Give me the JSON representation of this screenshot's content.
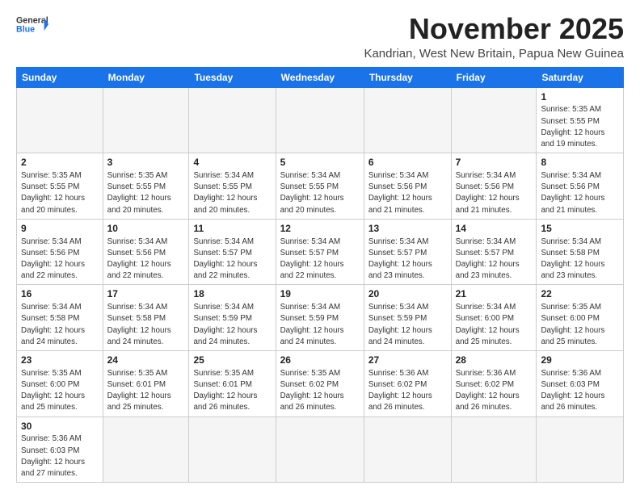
{
  "header": {
    "logo_line1": "General",
    "logo_line2": "Blue",
    "month_title": "November 2025",
    "location": "Kandrian, West New Britain, Papua New Guinea"
  },
  "days_of_week": [
    "Sunday",
    "Monday",
    "Tuesday",
    "Wednesday",
    "Thursday",
    "Friday",
    "Saturday"
  ],
  "weeks": [
    [
      {
        "day": "",
        "info": ""
      },
      {
        "day": "",
        "info": ""
      },
      {
        "day": "",
        "info": ""
      },
      {
        "day": "",
        "info": ""
      },
      {
        "day": "",
        "info": ""
      },
      {
        "day": "",
        "info": ""
      },
      {
        "day": "1",
        "info": "Sunrise: 5:35 AM\nSunset: 5:55 PM\nDaylight: 12 hours\nand 19 minutes."
      }
    ],
    [
      {
        "day": "2",
        "info": "Sunrise: 5:35 AM\nSunset: 5:55 PM\nDaylight: 12 hours\nand 20 minutes."
      },
      {
        "day": "3",
        "info": "Sunrise: 5:35 AM\nSunset: 5:55 PM\nDaylight: 12 hours\nand 20 minutes."
      },
      {
        "day": "4",
        "info": "Sunrise: 5:34 AM\nSunset: 5:55 PM\nDaylight: 12 hours\nand 20 minutes."
      },
      {
        "day": "5",
        "info": "Sunrise: 5:34 AM\nSunset: 5:55 PM\nDaylight: 12 hours\nand 20 minutes."
      },
      {
        "day": "6",
        "info": "Sunrise: 5:34 AM\nSunset: 5:56 PM\nDaylight: 12 hours\nand 21 minutes."
      },
      {
        "day": "7",
        "info": "Sunrise: 5:34 AM\nSunset: 5:56 PM\nDaylight: 12 hours\nand 21 minutes."
      },
      {
        "day": "8",
        "info": "Sunrise: 5:34 AM\nSunset: 5:56 PM\nDaylight: 12 hours\nand 21 minutes."
      }
    ],
    [
      {
        "day": "9",
        "info": "Sunrise: 5:34 AM\nSunset: 5:56 PM\nDaylight: 12 hours\nand 22 minutes."
      },
      {
        "day": "10",
        "info": "Sunrise: 5:34 AM\nSunset: 5:56 PM\nDaylight: 12 hours\nand 22 minutes."
      },
      {
        "day": "11",
        "info": "Sunrise: 5:34 AM\nSunset: 5:57 PM\nDaylight: 12 hours\nand 22 minutes."
      },
      {
        "day": "12",
        "info": "Sunrise: 5:34 AM\nSunset: 5:57 PM\nDaylight: 12 hours\nand 22 minutes."
      },
      {
        "day": "13",
        "info": "Sunrise: 5:34 AM\nSunset: 5:57 PM\nDaylight: 12 hours\nand 23 minutes."
      },
      {
        "day": "14",
        "info": "Sunrise: 5:34 AM\nSunset: 5:57 PM\nDaylight: 12 hours\nand 23 minutes."
      },
      {
        "day": "15",
        "info": "Sunrise: 5:34 AM\nSunset: 5:58 PM\nDaylight: 12 hours\nand 23 minutes."
      }
    ],
    [
      {
        "day": "16",
        "info": "Sunrise: 5:34 AM\nSunset: 5:58 PM\nDaylight: 12 hours\nand 24 minutes."
      },
      {
        "day": "17",
        "info": "Sunrise: 5:34 AM\nSunset: 5:58 PM\nDaylight: 12 hours\nand 24 minutes."
      },
      {
        "day": "18",
        "info": "Sunrise: 5:34 AM\nSunset: 5:59 PM\nDaylight: 12 hours\nand 24 minutes."
      },
      {
        "day": "19",
        "info": "Sunrise: 5:34 AM\nSunset: 5:59 PM\nDaylight: 12 hours\nand 24 minutes."
      },
      {
        "day": "20",
        "info": "Sunrise: 5:34 AM\nSunset: 5:59 PM\nDaylight: 12 hours\nand 24 minutes."
      },
      {
        "day": "21",
        "info": "Sunrise: 5:34 AM\nSunset: 6:00 PM\nDaylight: 12 hours\nand 25 minutes."
      },
      {
        "day": "22",
        "info": "Sunrise: 5:35 AM\nSunset: 6:00 PM\nDaylight: 12 hours\nand 25 minutes."
      }
    ],
    [
      {
        "day": "23",
        "info": "Sunrise: 5:35 AM\nSunset: 6:00 PM\nDaylight: 12 hours\nand 25 minutes."
      },
      {
        "day": "24",
        "info": "Sunrise: 5:35 AM\nSunset: 6:01 PM\nDaylight: 12 hours\nand 25 minutes."
      },
      {
        "day": "25",
        "info": "Sunrise: 5:35 AM\nSunset: 6:01 PM\nDaylight: 12 hours\nand 26 minutes."
      },
      {
        "day": "26",
        "info": "Sunrise: 5:35 AM\nSunset: 6:02 PM\nDaylight: 12 hours\nand 26 minutes."
      },
      {
        "day": "27",
        "info": "Sunrise: 5:36 AM\nSunset: 6:02 PM\nDaylight: 12 hours\nand 26 minutes."
      },
      {
        "day": "28",
        "info": "Sunrise: 5:36 AM\nSunset: 6:02 PM\nDaylight: 12 hours\nand 26 minutes."
      },
      {
        "day": "29",
        "info": "Sunrise: 5:36 AM\nSunset: 6:03 PM\nDaylight: 12 hours\nand 26 minutes."
      }
    ],
    [
      {
        "day": "30",
        "info": "Sunrise: 5:36 AM\nSunset: 6:03 PM\nDaylight: 12 hours\nand 27 minutes."
      },
      {
        "day": "",
        "info": ""
      },
      {
        "day": "",
        "info": ""
      },
      {
        "day": "",
        "info": ""
      },
      {
        "day": "",
        "info": ""
      },
      {
        "day": "",
        "info": ""
      },
      {
        "day": "",
        "info": ""
      }
    ]
  ]
}
